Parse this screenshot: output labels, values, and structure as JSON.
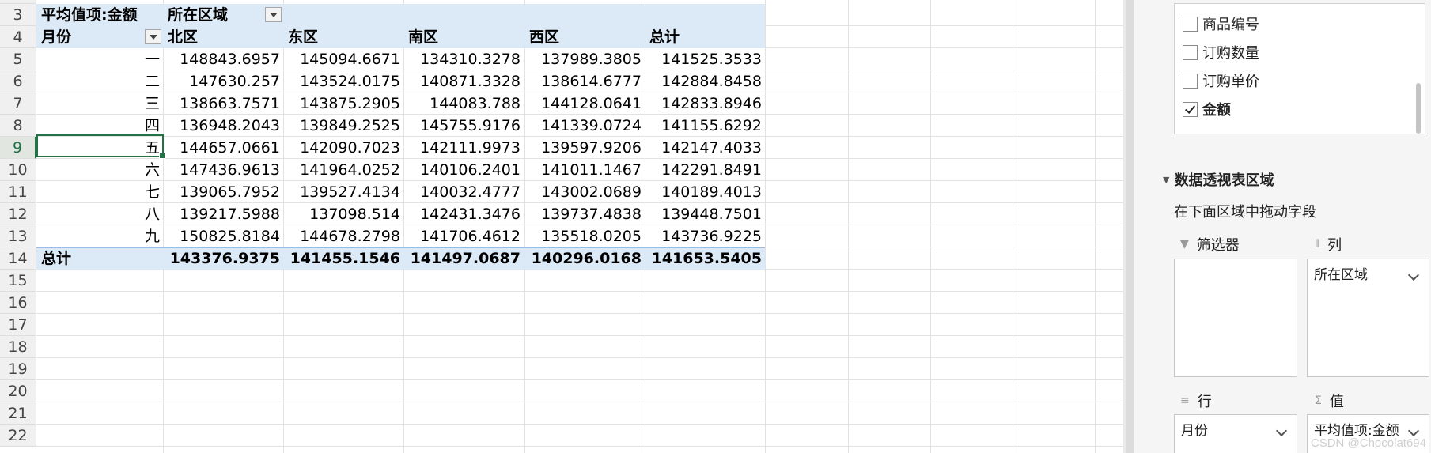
{
  "spreadsheet": {
    "row_numbers": [
      "3",
      "4",
      "5",
      "6",
      "7",
      "8",
      "9",
      "10",
      "11",
      "12",
      "13",
      "14",
      "15",
      "16",
      "17",
      "18",
      "19",
      "20",
      "21",
      "22"
    ],
    "pivot": {
      "value_label": "平均值项:金额",
      "column_field_label": "所在区域",
      "row_field_label": "月份",
      "columns": [
        "北区",
        "东区",
        "南区",
        "西区",
        "总计"
      ],
      "rows": [
        {
          "label": "一",
          "values": [
            "148843.6957",
            "145094.6671",
            "134310.3278",
            "137989.3805",
            "141525.3533"
          ]
        },
        {
          "label": "二",
          "values": [
            "147630.257",
            "143524.0175",
            "140871.3328",
            "138614.6777",
            "142884.8458"
          ]
        },
        {
          "label": "三",
          "values": [
            "138663.7571",
            "143875.2905",
            "144083.788",
            "144128.0641",
            "142833.8946"
          ]
        },
        {
          "label": "四",
          "values": [
            "136948.2043",
            "139849.2525",
            "145755.9176",
            "141339.0724",
            "141155.6292"
          ]
        },
        {
          "label": "五",
          "values": [
            "144657.0661",
            "142090.7023",
            "142111.9973",
            "139597.9206",
            "142147.4033"
          ]
        },
        {
          "label": "六",
          "values": [
            "147436.9613",
            "141964.0252",
            "140106.2401",
            "141011.1467",
            "142291.8491"
          ]
        },
        {
          "label": "七",
          "values": [
            "139065.7952",
            "139527.4134",
            "140032.4777",
            "143002.0689",
            "140189.4013"
          ]
        },
        {
          "label": "八",
          "values": [
            "139217.5988",
            "137098.514",
            "142431.3476",
            "139737.4838",
            "139448.7501"
          ]
        },
        {
          "label": "九",
          "values": [
            "150825.8184",
            "144678.2798",
            "141706.4612",
            "135518.0205",
            "143736.9225"
          ]
        }
      ],
      "total_row": {
        "label": "总计",
        "values": [
          "143376.9375",
          "141455.1546",
          "141497.0687",
          "140296.0168",
          "141653.5405"
        ]
      }
    },
    "selected_row": "9"
  },
  "pivot_pane": {
    "fields": [
      {
        "label": "商品编号",
        "checked": false
      },
      {
        "label": "订购数量",
        "checked": false
      },
      {
        "label": "订购单价",
        "checked": false
      },
      {
        "label": "金额",
        "checked": true
      }
    ],
    "areas_title": "数据透视表区域",
    "areas_hint": "在下面区域中拖动字段",
    "filter_label": "筛选器",
    "columns_label": "列",
    "rows_label": "行",
    "values_label": "值",
    "columns_item": "所在区域",
    "rows_item": "月份",
    "values_item": "平均值项:金额"
  },
  "watermark": "CSDN @Chocolat694"
}
